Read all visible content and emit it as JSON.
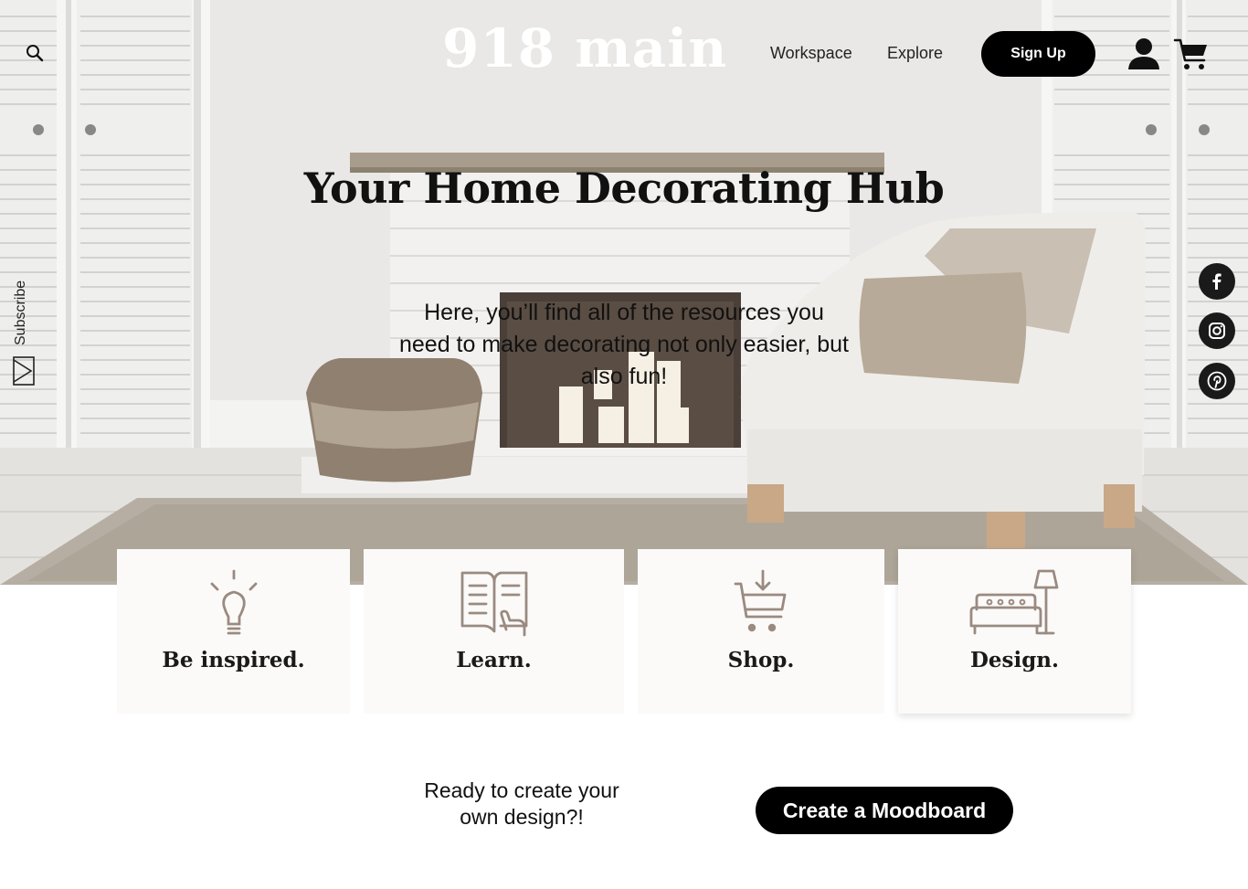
{
  "header": {
    "logo": "918 main",
    "nav": {
      "workspace": "Workspace",
      "explore": "Explore"
    },
    "signup_label": "Sign Up",
    "icons": {
      "search": "search-icon",
      "account": "user-icon",
      "cart": "cart-icon"
    }
  },
  "sidebar": {
    "subscribe_label": "Subscribe"
  },
  "hero": {
    "title": "Your Home Decorating Hub",
    "description": "Here, you’ll find all of the resources you need to make decorating not only easier, but also fun!"
  },
  "social": [
    "facebook-icon",
    "instagram-icon",
    "pinterest-icon"
  ],
  "cards": [
    {
      "label": "Be inspired.",
      "icon": "lightbulb-icon"
    },
    {
      "label": "Learn.",
      "icon": "book-icon"
    },
    {
      "label": "Shop.",
      "icon": "shopping-cart-icon"
    },
    {
      "label": "Design.",
      "icon": "sofa-lamp-icon"
    }
  ],
  "cta": {
    "text": "Ready to create your own design?!",
    "button_label": "Create a Moodboard"
  },
  "colors": {
    "accent": "#000000",
    "icon_stroke": "#9a8a80",
    "card_bg": "#fbfaf9"
  }
}
